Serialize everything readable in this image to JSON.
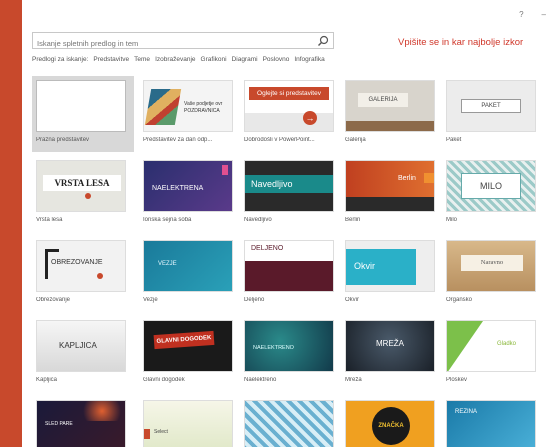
{
  "window": {
    "help": "?",
    "minimize": "–"
  },
  "search": {
    "placeholder": "Iskanje spletnih predlog in tem"
  },
  "signin": "Vpišite se in kar najbolje izkor",
  "suggested": {
    "label": "Predlogi za iskanje:",
    "items": [
      "Predstavitve",
      "Teme",
      "Izobraževanje",
      "Grafikoni",
      "Diagrami",
      "Poslovno",
      "Infografika"
    ]
  },
  "templates": [
    {
      "name": "Prazna predstavitev",
      "title": ""
    },
    {
      "name": "Predstavitev za dan odp...",
      "title": "Vaše podjetje ovr\nPOZDRAVNICA"
    },
    {
      "name": "Dobrodošli v PowerPoint...",
      "title": "Oglejte si predstavitev"
    },
    {
      "name": "Galerija",
      "title": "GALERIJA"
    },
    {
      "name": "Paket",
      "title": "PAKET"
    },
    {
      "name": "Vrsta lesa",
      "title": "VRSTA LESA"
    },
    {
      "name": "Ionska sejna soba",
      "title": "NAELEKTRENA"
    },
    {
      "name": "Navedljivo",
      "title": "Navedljivo"
    },
    {
      "name": "Berlin",
      "title": "Berlin"
    },
    {
      "name": "Milo",
      "title": "MILO"
    },
    {
      "name": "Obrezovanje",
      "title": "OBREZOVANJE"
    },
    {
      "name": "Vezje",
      "title": "VEZJE"
    },
    {
      "name": "Deljeno",
      "title": "DELJENO"
    },
    {
      "name": "Okvir",
      "title": "Okvir"
    },
    {
      "name": "Organsko",
      "title": "Naravno"
    },
    {
      "name": "Kapljica",
      "title": "KAPLJICA"
    },
    {
      "name": "Glavni dogodek",
      "title": "GLAVNI DOGODEK"
    },
    {
      "name": "Naelektreno",
      "title": "NAELEKTRENO"
    },
    {
      "name": "Mreža",
      "title": "MREŽA"
    },
    {
      "name": "Ploskev",
      "title": "Gladko"
    },
    {
      "name": "",
      "title": "SLED PARE"
    },
    {
      "name": "",
      "title": "Select"
    },
    {
      "name": "",
      "title": ""
    },
    {
      "name": "",
      "title": "ZNAČKA"
    },
    {
      "name": "",
      "title": "REZINA"
    }
  ],
  "colors": {
    "accent": "#c8492c",
    "signin": "#d0382b"
  }
}
